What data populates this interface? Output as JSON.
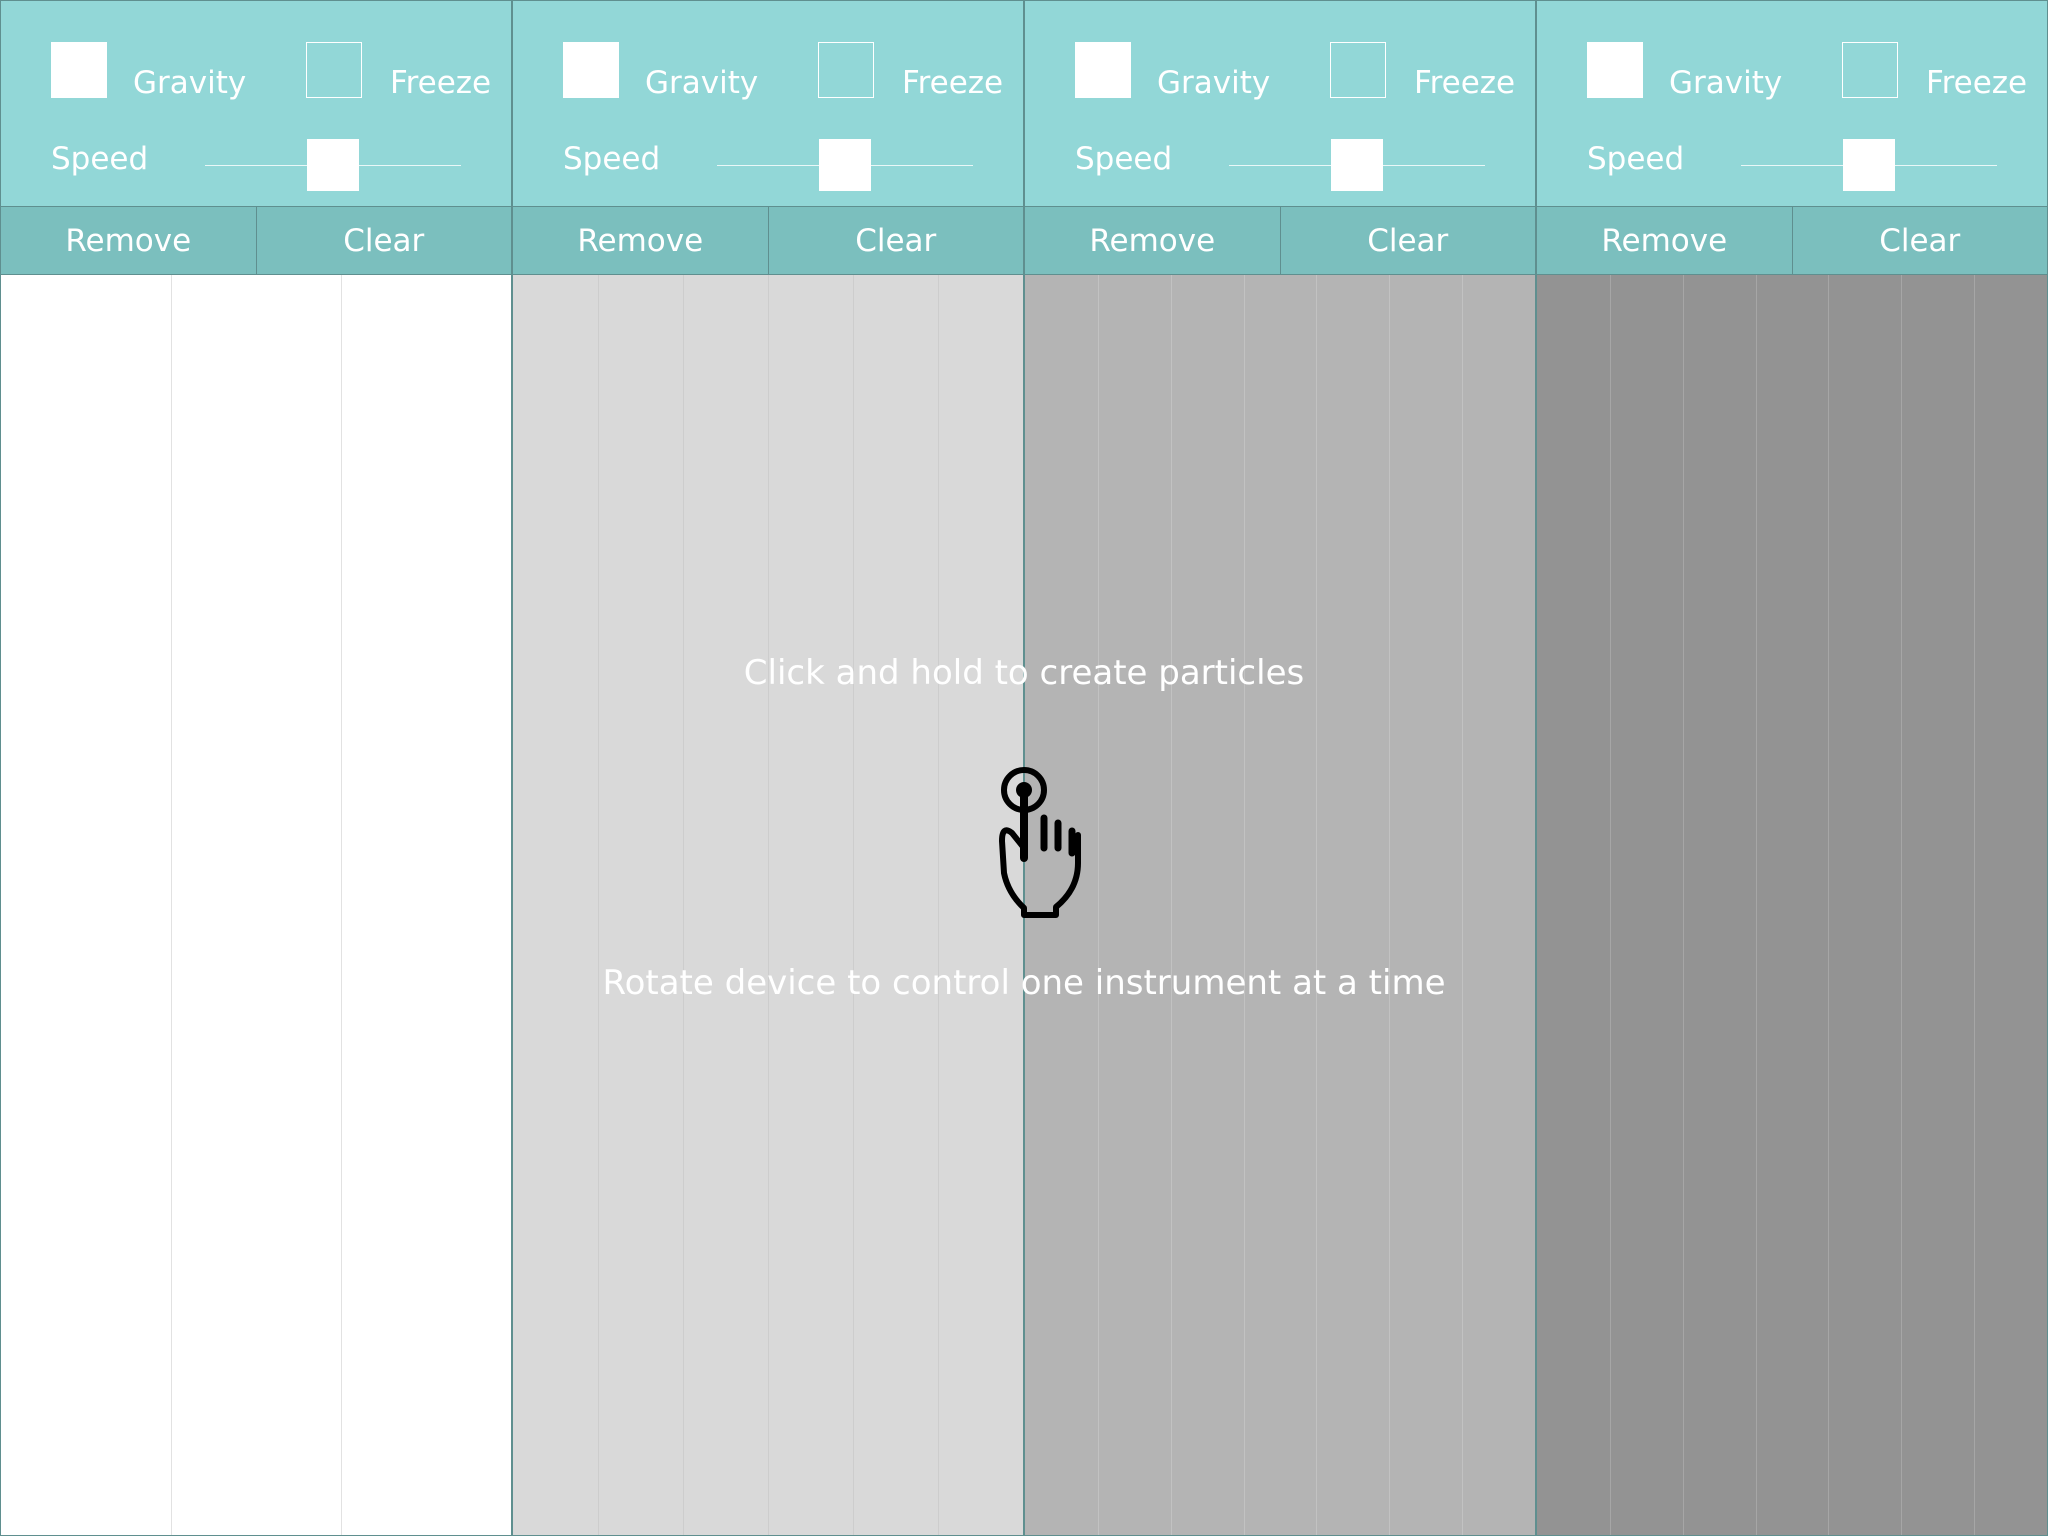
{
  "instruments": [
    {
      "gravity_label": "Gravity",
      "freeze_label": "Freeze",
      "speed_label": "Speed",
      "gravity_checked": true,
      "freeze_checked": false,
      "speed_fraction": 0.5,
      "remove_label": "Remove",
      "clear_label": "Clear",
      "canvas_color": "#ffffff",
      "lane_color": "#e2e2e2",
      "lane_count": 3
    },
    {
      "gravity_label": "Gravity",
      "freeze_label": "Freeze",
      "speed_label": "Speed",
      "gravity_checked": true,
      "freeze_checked": false,
      "speed_fraction": 0.5,
      "remove_label": "Remove",
      "clear_label": "Clear",
      "canvas_color": "#d9d9d9",
      "lane_color": "#cdcdcd",
      "lane_count": 6
    },
    {
      "gravity_label": "Gravity",
      "freeze_label": "Freeze",
      "speed_label": "Speed",
      "gravity_checked": true,
      "freeze_checked": false,
      "speed_fraction": 0.5,
      "remove_label": "Remove",
      "clear_label": "Clear",
      "canvas_color": "#b4b4b4",
      "lane_color": "#c2c2c2",
      "lane_count": 7
    },
    {
      "gravity_label": "Gravity",
      "freeze_label": "Freeze",
      "speed_label": "Speed",
      "gravity_checked": true,
      "freeze_checked": false,
      "speed_fraction": 0.5,
      "remove_label": "Remove",
      "clear_label": "Clear",
      "canvas_color": "#939393",
      "lane_color": "#a6a6a6",
      "lane_count": 7
    }
  ],
  "overlay": {
    "create_hint": "Click and hold to create particles",
    "rotate_hint": "Rotate device to control one instrument at a time",
    "hand_icon": "tap-hand-icon"
  },
  "colors": {
    "controls_bg": "#92d7d7",
    "buttons_bg": "#7bbfbe"
  }
}
